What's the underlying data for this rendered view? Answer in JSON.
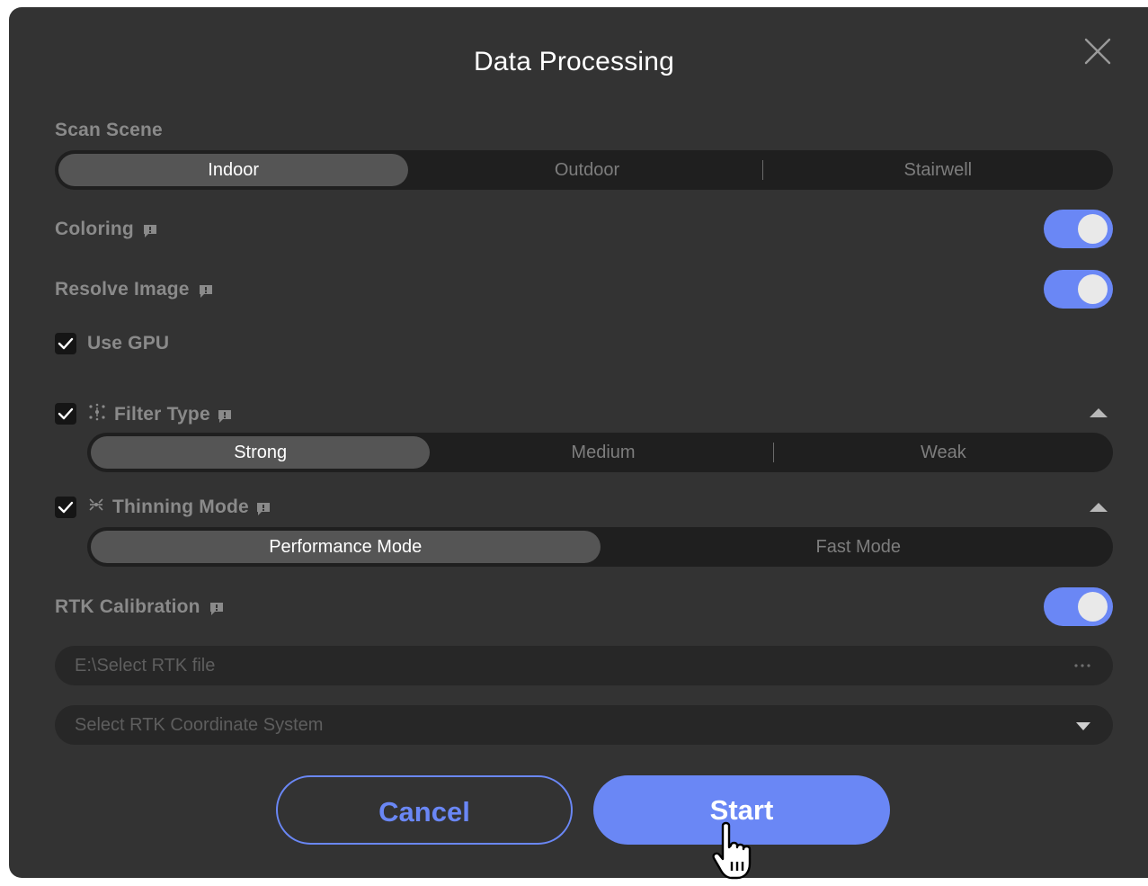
{
  "dialog": {
    "title": "Data Processing",
    "close_icon": "close-icon"
  },
  "scan_scene": {
    "label": "Scan Scene",
    "options": [
      "Indoor",
      "Outdoor",
      "Stairwell"
    ],
    "selected": "Indoor"
  },
  "coloring": {
    "label": "Coloring",
    "enabled": true
  },
  "resolve_image": {
    "label": "Resolve Image",
    "enabled": true
  },
  "use_gpu": {
    "label": "Use GPU",
    "checked": true
  },
  "filter_type": {
    "label": "Filter Type",
    "checked": true,
    "icon": "filter-icon",
    "options": [
      "Strong",
      "Medium",
      "Weak"
    ],
    "selected": "Strong"
  },
  "thinning_mode": {
    "label": "Thinning Mode",
    "checked": true,
    "icon": "thinning-icon",
    "options": [
      "Performance Mode",
      "Fast Mode"
    ],
    "selected": "Performance Mode"
  },
  "rtk_calibration": {
    "label": "RTK Calibration",
    "enabled": true,
    "file_placeholder": "E:\\Select RTK file",
    "coord_placeholder": "Select RTK Coordinate System"
  },
  "actions": {
    "cancel": "Cancel",
    "start": "Start"
  },
  "colors": {
    "dialog_bg": "#333333",
    "accent": "#6a87f5",
    "segment_bg": "#1f1f1f",
    "segment_active": "#555555"
  }
}
